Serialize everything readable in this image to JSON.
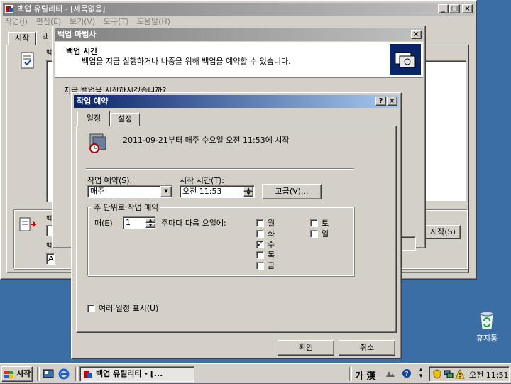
{
  "main_window": {
    "title": "백업 유틸리티 - [제목없음]",
    "menu": [
      "작업(J)",
      "편집(E)",
      "보기(V)",
      "도구(T)",
      "도움말(H)"
    ],
    "tabs": [
      "시작",
      "백"
    ],
    "partial_labels": [
      "백",
      "백",
      "백"
    ],
    "path_field": "A:\\Ba",
    "start_button": "시작(S)"
  },
  "wizard": {
    "title": "백업 마법사",
    "header_title": "백업 시간",
    "header_subtitle": "백업을 지금 실행하거나 나중을 위해 백업을 예약할 수 있습니다.",
    "question": "지금 백업을 시작하시겠습니까?"
  },
  "schedule_dialog": {
    "title": "작업 예약",
    "help_button": "?",
    "close_button": "×",
    "tabs": [
      "일정",
      "설정"
    ],
    "summary": "2011-09-21부터 매주 수요일 오전 11:53에 시작",
    "schedule_label": "작업 예약(S):",
    "schedule_value": "매주",
    "start_time_label": "시작 시간(T):",
    "start_time_value": "오전 11:53",
    "advanced_button": "고급(V)...",
    "weekly_group_label": "주 단위로 작업 예약",
    "every_label": "매(E)",
    "every_value": "1",
    "weeks_label": "주마다 다음 요일에:",
    "days": [
      {
        "label": "월",
        "checked": false
      },
      {
        "label": "화",
        "checked": false
      },
      {
        "label": "수",
        "checked": true
      },
      {
        "label": "목",
        "checked": false
      },
      {
        "label": "금",
        "checked": false
      },
      {
        "label": "토",
        "checked": false
      },
      {
        "label": "일",
        "checked": false
      }
    ],
    "multi_schedule_label": "여러 일정 표시(U)",
    "multi_schedule_checked": false,
    "ok_button": "확인",
    "cancel_button": "취소"
  },
  "desktop": {
    "recycle_bin_label": "휴지통"
  },
  "taskbar": {
    "start_label": "시작",
    "task_label": "백업 유틸리티 - [...",
    "ime_text": "가 漢",
    "clock": "오전 11:51"
  },
  "colors": {
    "desktop": "#3a6ea5",
    "title_active": "#0a246a",
    "face": "#d4d0c8"
  }
}
